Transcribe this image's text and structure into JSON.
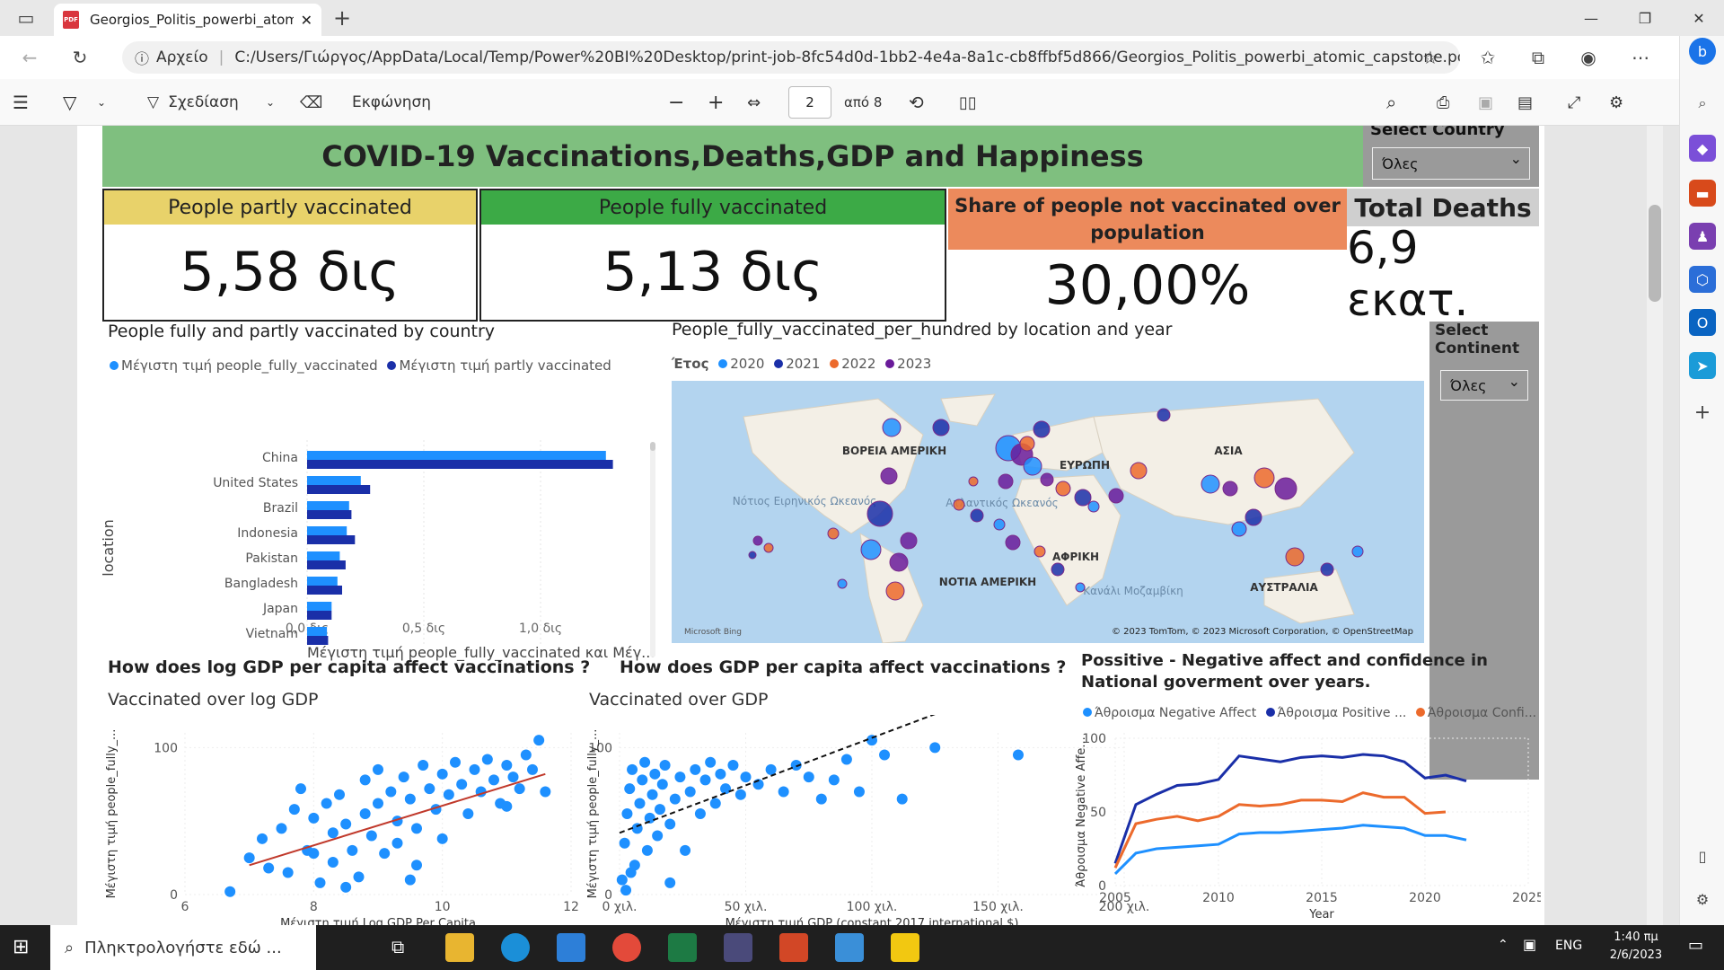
{
  "browser": {
    "tab_title": "Georgios_Politis_powerbi_atomic",
    "file_label": "Αρχείο",
    "url": "C:/Users/Γιώργος/AppData/Local/Temp/Power%20BI%20Desktop/print-job-8fc54d0d-1bb2-4e4a-8a1c-cb8ffbf5d866/Georgios_Politis_powerbi_atomic_capstone.pdf"
  },
  "pdf_toolbar": {
    "draw_label": "Σχεδίαση",
    "read_aloud_label": "Εκφώνηση",
    "page_number": "2",
    "page_total": "από 8"
  },
  "dashboard": {
    "title": "COVID-19 Vaccinations,Deaths,GDP and Happiness",
    "select_country_label": "Select Country",
    "select_country_value": "Όλες",
    "select_continent_label": "Select Continent",
    "select_continent_value": "Όλες",
    "kpis": [
      {
        "label": "People partly vaccinated",
        "value": "5,58 δις",
        "color": "#e8d26a"
      },
      {
        "label": "People fully vaccinated",
        "value": "5,13 δις",
        "color": "#3caa46"
      },
      {
        "label": "Share of people not vaccinated over population",
        "value": "30,00%",
        "color": "#ec8a5c"
      },
      {
        "label": "Total Deaths",
        "value": "6,9 εκατ.",
        "color": "#cfcfcf"
      }
    ]
  },
  "chart_data": [
    {
      "type": "bar",
      "title": "People fully and partly vaccinated by country",
      "ylabel": "location",
      "xlabel": "Μέγιστη τιμή people_fully_vaccinated και Μέγ...",
      "categories": [
        "China",
        "United States",
        "Brazil",
        "Indonesia",
        "Pakistan",
        "Bangladesh",
        "Japan",
        "Vietnam"
      ],
      "series": [
        {
          "name": "Μέγιστη τιμή people_fully_vaccinated",
          "color": "#1e90ff",
          "values": [
            1.28,
            0.23,
            0.18,
            0.17,
            0.14,
            0.13,
            0.105,
            0.085
          ]
        },
        {
          "name": "Μέγιστη τιμή partly vaccinated",
          "color": "#1a2fa8",
          "values": [
            1.31,
            0.27,
            0.19,
            0.205,
            0.165,
            0.15,
            0.105,
            0.09
          ]
        }
      ],
      "xticks": [
        "0,0 δις",
        "0,5 δις",
        "1,0 δις"
      ],
      "xlim": [
        0,
        1.4
      ]
    },
    {
      "type": "map",
      "title": "People_fully_vaccinated_per_hundred by location and year",
      "legend_title": "Έτος",
      "series": [
        {
          "name": "2020",
          "color": "#1e90ff"
        },
        {
          "name": "2021",
          "color": "#1a2fa8"
        },
        {
          "name": "2022",
          "color": "#ec6a2c"
        },
        {
          "name": "2023",
          "color": "#6a1b9a"
        }
      ],
      "labels": [
        "ΒΟΡΕΙΑ ΑΜΕΡΙΚΗ",
        "Νότιος Ειρηνικός Ωκεανός",
        "Ατλαντικός Ωκεανός",
        "ΕΥΡΩΠΗ",
        "ΑΣΙΑ",
        "ΑΦΡΙΚΗ",
        "ΝΟΤΙΑ ΑΜΕΡΙΚΗ",
        "Κανάλι Μοζαμβίκη",
        "ΑΥΣΤΡΑΛΙΑ"
      ],
      "attribution": "© 2023 TomTom, © 2023 Microsoft Corporation, © OpenStreetMap",
      "logo": "Microsoft Bing"
    },
    {
      "type": "scatter",
      "title": "How does log GDP per capita affect vaccinations ?",
      "subtitle": "Vaccinated over log GDP",
      "xlabel": "Μέγιστη τιμή Log GDP Per Capita",
      "ylabel": "Μέγιστη τιμή people_fully_...",
      "xlim": [
        6,
        12
      ],
      "ylim": [
        0,
        110
      ],
      "xticks": [
        "6",
        "8",
        "10",
        "12"
      ],
      "yticks": [
        "0",
        "100"
      ],
      "trend": {
        "x": [
          7,
          11.6
        ],
        "y": [
          20,
          82
        ],
        "color": "#c0392b"
      },
      "points": [
        [
          6.7,
          2
        ],
        [
          7.0,
          25
        ],
        [
          7.2,
          38
        ],
        [
          7.3,
          18
        ],
        [
          7.5,
          45
        ],
        [
          7.6,
          15
        ],
        [
          7.7,
          58
        ],
        [
          7.8,
          72
        ],
        [
          7.9,
          30
        ],
        [
          8.0,
          52
        ],
        [
          8.0,
          28
        ],
        [
          8.1,
          8
        ],
        [
          8.2,
          62
        ],
        [
          8.3,
          42
        ],
        [
          8.3,
          22
        ],
        [
          8.4,
          68
        ],
        [
          8.5,
          48
        ],
        [
          8.6,
          30
        ],
        [
          8.7,
          12
        ],
        [
          8.8,
          78
        ],
        [
          8.8,
          55
        ],
        [
          8.9,
          40
        ],
        [
          9.0,
          85
        ],
        [
          9.0,
          62
        ],
        [
          9.1,
          28
        ],
        [
          9.2,
          70
        ],
        [
          9.3,
          50
        ],
        [
          9.3,
          35
        ],
        [
          9.4,
          80
        ],
        [
          9.5,
          65
        ],
        [
          9.6,
          45
        ],
        [
          9.6,
          20
        ],
        [
          9.7,
          88
        ],
        [
          9.8,
          72
        ],
        [
          9.9,
          58
        ],
        [
          10.0,
          82
        ],
        [
          10.0,
          38
        ],
        [
          10.1,
          68
        ],
        [
          10.2,
          90
        ],
        [
          10.3,
          75
        ],
        [
          10.4,
          55
        ],
        [
          10.5,
          85
        ],
        [
          10.6,
          70
        ],
        [
          10.7,
          92
        ],
        [
          10.8,
          78
        ],
        [
          10.9,
          62
        ],
        [
          11.0,
          88
        ],
        [
          11.1,
          80
        ],
        [
          11.2,
          72
        ],
        [
          11.3,
          95
        ],
        [
          11.4,
          85
        ],
        [
          11.5,
          105
        ],
        [
          11.6,
          70
        ],
        [
          11.0,
          60
        ],
        [
          9.5,
          10
        ],
        [
          8.5,
          5
        ]
      ]
    },
    {
      "type": "scatter",
      "title": "How does GDP per capita affect vaccinations ?",
      "subtitle": "Vaccinated over GDP",
      "xlabel": "Μέγιστη τιμή GDP (constant 2017 international $)",
      "ylabel": "Μέγιστη τιμή people_fully_...",
      "xlim": [
        0,
        200000
      ],
      "ylim": [
        0,
        110
      ],
      "xticks": [
        "0 χιλ.",
        "50 χιλ.",
        "100 χιλ.",
        "150 χιλ.",
        "200 χιλ."
      ],
      "yticks": [
        "0",
        "100"
      ],
      "trend": {
        "x": [
          0,
          130000
        ],
        "y": [
          42,
          126
        ],
        "color": "#111"
      },
      "points": [
        [
          1000,
          10
        ],
        [
          2000,
          35
        ],
        [
          3000,
          55
        ],
        [
          4000,
          72
        ],
        [
          5000,
          85
        ],
        [
          6000,
          20
        ],
        [
          7000,
          45
        ],
        [
          8000,
          62
        ],
        [
          9000,
          78
        ],
        [
          10000,
          90
        ],
        [
          11000,
          30
        ],
        [
          12000,
          52
        ],
        [
          13000,
          68
        ],
        [
          14000,
          82
        ],
        [
          15000,
          40
        ],
        [
          16000,
          58
        ],
        [
          17000,
          75
        ],
        [
          18000,
          88
        ],
        [
          20000,
          48
        ],
        [
          22000,
          65
        ],
        [
          24000,
          80
        ],
        [
          26000,
          30
        ],
        [
          28000,
          70
        ],
        [
          30000,
          85
        ],
        [
          32000,
          55
        ],
        [
          34000,
          78
        ],
        [
          36000,
          90
        ],
        [
          38000,
          62
        ],
        [
          40000,
          82
        ],
        [
          42000,
          72
        ],
        [
          45000,
          88
        ],
        [
          48000,
          68
        ],
        [
          50000,
          80
        ],
        [
          55000,
          75
        ],
        [
          60000,
          85
        ],
        [
          65000,
          70
        ],
        [
          70000,
          88
        ],
        [
          75000,
          80
        ],
        [
          80000,
          65
        ],
        [
          85000,
          78
        ],
        [
          90000,
          92
        ],
        [
          95000,
          70
        ],
        [
          100000,
          105
        ],
        [
          105000,
          95
        ],
        [
          112000,
          65
        ],
        [
          125000,
          100
        ],
        [
          158000,
          95
        ],
        [
          2500,
          3
        ],
        [
          4500,
          15
        ],
        [
          20000,
          8
        ]
      ]
    },
    {
      "type": "line",
      "title": "Possitive - Negative affect and confidence in National goverment over years.",
      "xlabel": "Year",
      "ylabel": "Άθροισμα Negative Affe...",
      "xlim": [
        2005,
        2025
      ],
      "ylim": [
        0,
        100
      ],
      "xticks": [
        "2005",
        "2010",
        "2015",
        "2020",
        "2025"
      ],
      "yticks": [
        "0",
        "50",
        "100"
      ],
      "x": [
        2005,
        2006,
        2007,
        2008,
        2009,
        2010,
        2011,
        2012,
        2013,
        2014,
        2015,
        2016,
        2017,
        2018,
        2019,
        2020,
        2021,
        2022
      ],
      "series": [
        {
          "name": "Άθροισμα Negative Affect",
          "color": "#1e90ff",
          "values": [
            8,
            22,
            25,
            26,
            27,
            28,
            35,
            36,
            36,
            37,
            38,
            39,
            41,
            40,
            39,
            34,
            34,
            31
          ]
        },
        {
          "name": "Άθροισμα Positive ...",
          "color": "#1a2fa8",
          "values": [
            15,
            55,
            62,
            68,
            69,
            72,
            88,
            86,
            84,
            87,
            88,
            87,
            89,
            88,
            84,
            73,
            75,
            71
          ]
        },
        {
          "name": "Άθροισμα Confi...",
          "color": "#ec6a2c",
          "values": [
            12,
            42,
            45,
            47,
            44,
            47,
            55,
            54,
            55,
            58,
            58,
            57,
            63,
            60,
            60,
            49,
            50,
            null
          ]
        }
      ]
    }
  ],
  "taskbar": {
    "search_placeholder": "Πληκτρολογήστε εδώ ...",
    "lang": "ENG",
    "time": "1:40 πμ",
    "date": "2/6/2023"
  }
}
